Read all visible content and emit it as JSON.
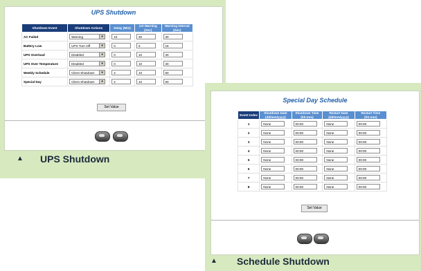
{
  "ups": {
    "title": "UPS Shutdown",
    "headers": [
      "Shutdown Event",
      "Shutdown Actions",
      "Delay (Min)",
      "1st Warning (Sec)",
      "Warning Interval (Sec)"
    ],
    "rows": [
      {
        "event": "AC Failed",
        "action": "Warning",
        "delay": "10",
        "first": "30",
        "interval": "30"
      },
      {
        "event": "Battery Low",
        "action": "UPS Turn Off",
        "delay": "0",
        "first": "5",
        "interval": "15"
      },
      {
        "event": "UPS Overload",
        "action": "Disabled",
        "delay": "0",
        "first": "10",
        "interval": "30"
      },
      {
        "event": "UPS Over Temperature",
        "action": "Disabled",
        "delay": "0",
        "first": "10",
        "interval": "30"
      },
      {
        "event": "Weekly Schedule",
        "action": "Client Shutdown",
        "delay": "2",
        "first": "10",
        "interval": "60"
      },
      {
        "event": "Special Day",
        "action": "Client Shutdown",
        "delay": "2",
        "first": "10",
        "interval": "60"
      }
    ],
    "set_value": "Set Value",
    "caption": "UPS Shutdown"
  },
  "special": {
    "title": "Special Day Schedule",
    "headers": [
      "Event Index",
      "Shutdown Date (dd/mm/yyyy)",
      "Shutdown Time (hh:mm)",
      "Restart Date (dd/mm/yyyy)",
      "Restart Time (hh:mm)"
    ],
    "rows": [
      {
        "index": "1",
        "sdate": "None",
        "stime": "00:00",
        "rdate": "None",
        "rtime": "00:00"
      },
      {
        "index": "2",
        "sdate": "None",
        "stime": "00:00",
        "rdate": "None",
        "rtime": "00:00"
      },
      {
        "index": "3",
        "sdate": "None",
        "stime": "00:00",
        "rdate": "None",
        "rtime": "00:00"
      },
      {
        "index": "4",
        "sdate": "None",
        "stime": "00:00",
        "rdate": "None",
        "rtime": "00:00"
      },
      {
        "index": "5",
        "sdate": "None",
        "stime": "00:00",
        "rdate": "None",
        "rtime": "00:00"
      },
      {
        "index": "6",
        "sdate": "None",
        "stime": "00:00",
        "rdate": "None",
        "rtime": "00:00"
      },
      {
        "index": "7",
        "sdate": "None",
        "stime": "00:00",
        "rdate": "None",
        "rtime": "00:00"
      },
      {
        "index": "8",
        "sdate": "None",
        "stime": "00:00",
        "rdate": "None",
        "rtime": "00:00"
      }
    ],
    "set_value": "Set Value",
    "caption": "Schedule Shutdown"
  },
  "icons": {
    "triangle": "triangle-up-icon",
    "nav": "nav-pill-icon"
  },
  "colors": {
    "panel": "#d7e9bf",
    "header_dark": "#1a3d7a",
    "header_light": "#5a8fd0",
    "title": "#1f5fa8"
  }
}
